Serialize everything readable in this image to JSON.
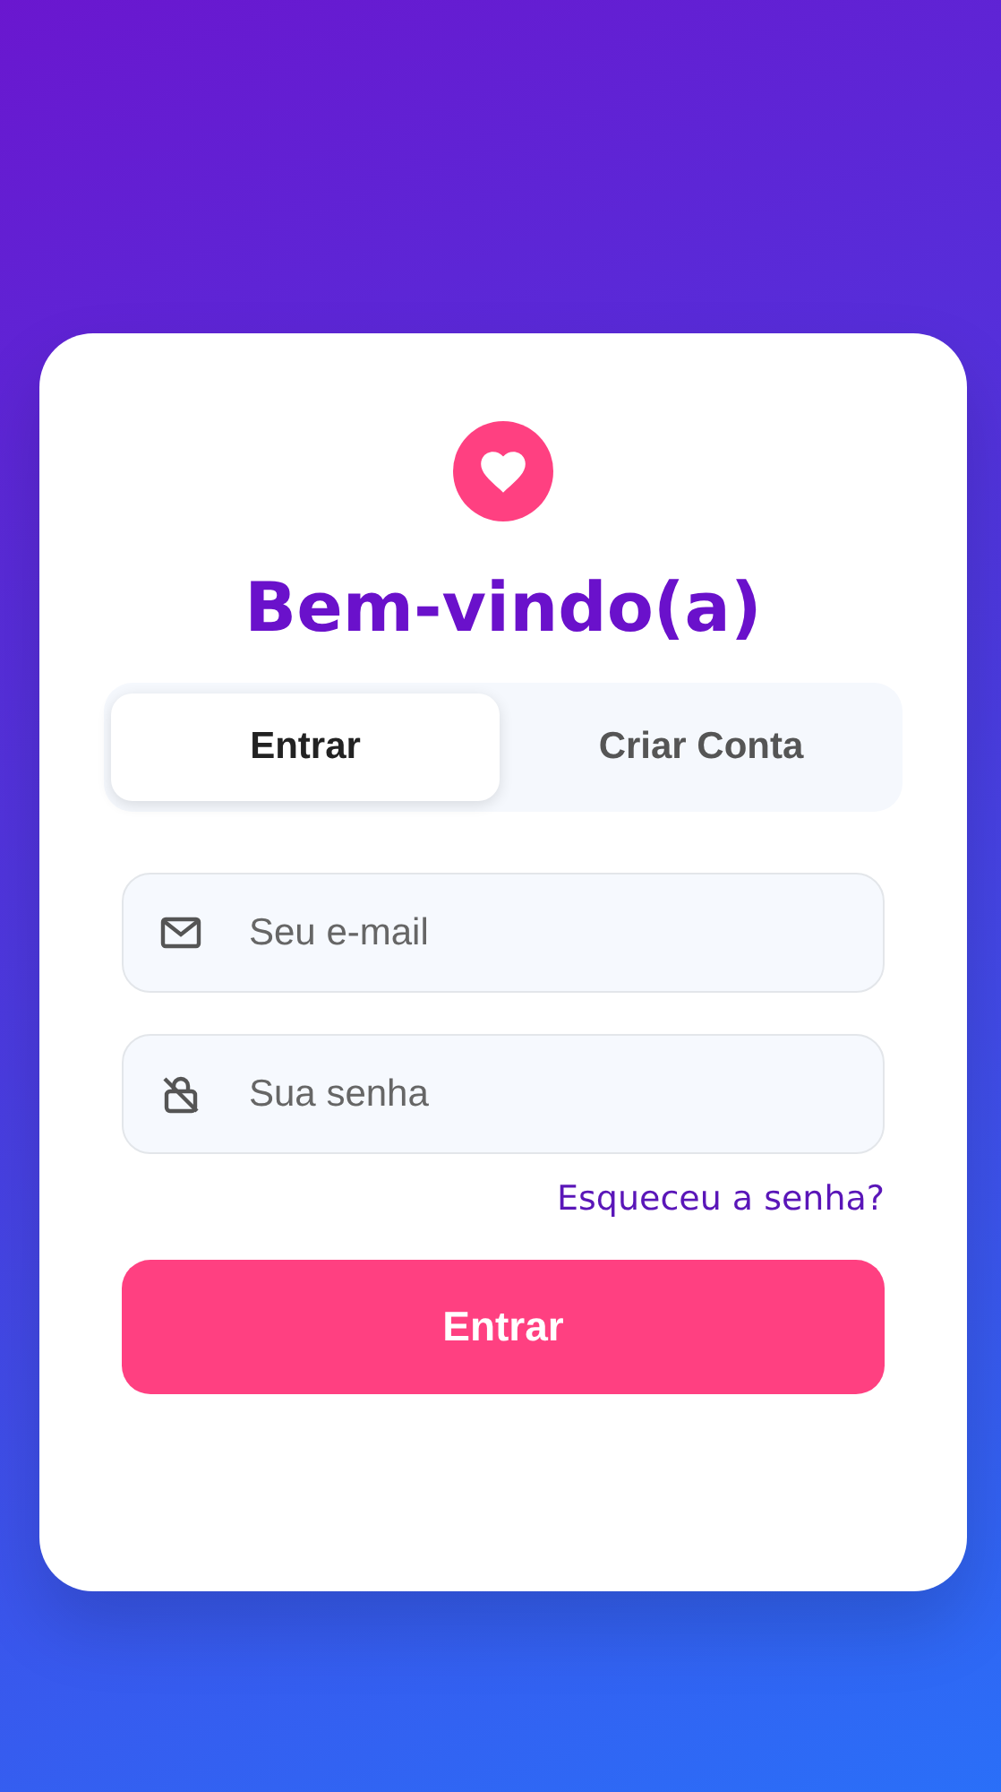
{
  "title": "Bem-vindo(a)",
  "tabs": [
    {
      "label": "Entrar",
      "selected": true
    },
    {
      "label": "Criar Conta",
      "selected": false
    }
  ],
  "fields": [
    {
      "kind": "email",
      "placeholder": "Seu e-mail"
    },
    {
      "kind": "password",
      "placeholder": "Sua senha"
    }
  ],
  "forgot_link": "Esqueceu a senha?",
  "submit_button": "Entrar"
}
